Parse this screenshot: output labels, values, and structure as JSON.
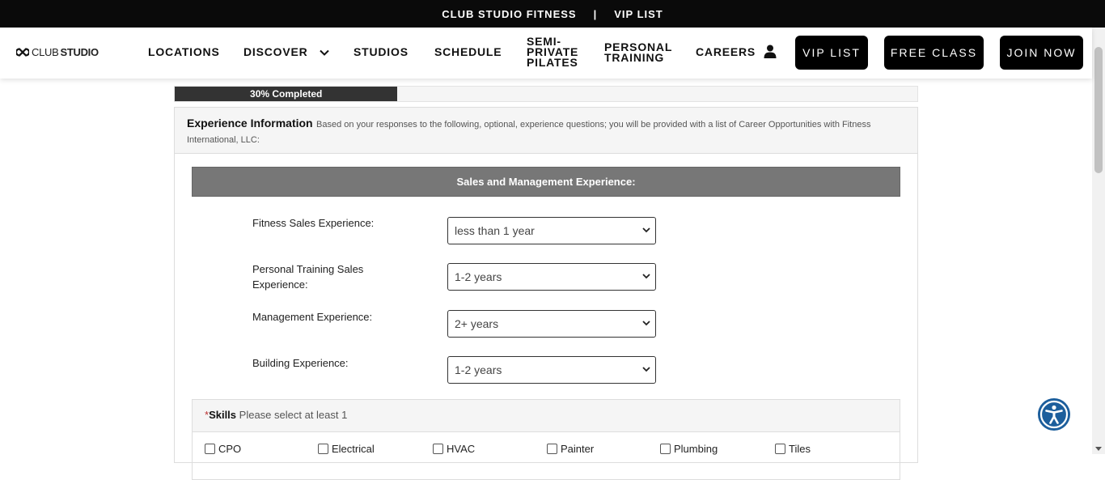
{
  "topbar": {
    "brand": "CLUB STUDIO FITNESS",
    "separator": "|",
    "vip": "VIP LIST"
  },
  "logo": {
    "club": "CLUB",
    "studio": "STUDIO"
  },
  "nav": {
    "locations": "LOCATIONS",
    "discover": "DISCOVER",
    "studios": "STUDIOS",
    "schedule": "SCHEDULE",
    "semi_line1": "SEMI-",
    "semi_line2": "PRIVATE",
    "semi_line3": "PILATES",
    "pt_line1": "PERSONAL",
    "pt_line2": "TRAINING",
    "careers": "CAREERS",
    "vip_button": "VIP LIST",
    "free_button": "FREE CLASS",
    "join_button": "JOIN NOW",
    "icons": [
      "infinity-logo-icon",
      "chevron-down-icon",
      "user-icon"
    ]
  },
  "progress": {
    "label": "30% Completed",
    "value": 0.3
  },
  "panel": {
    "title": "Experience Information",
    "description": "Based on your responses to the following, optional, experience questions; you will be provided with a list of Career Opportunities with Fitness International, LLC:"
  },
  "section": {
    "title": "Sales and Management Experience:"
  },
  "fields": [
    {
      "label": "Fitness Sales Experience:",
      "value": "less than 1 year"
    },
    {
      "label": "Personal Training Sales Experience:",
      "value": "1-2 years"
    },
    {
      "label": "Management Experience:",
      "value": "2+ years"
    },
    {
      "label": "Building Experience:",
      "value": "1-2 years"
    }
  ],
  "skills": {
    "required_mark": "*",
    "label": "Skills",
    "hint": "Please select at least 1",
    "options": [
      "CPO",
      "Electrical",
      "HVAC",
      "Painter",
      "Plumbing",
      "Tiles"
    ]
  },
  "colors": {
    "black": "#000000",
    "section_bar": "#777777",
    "accessibility": "#1c5e9c",
    "required": "#bb3333"
  }
}
